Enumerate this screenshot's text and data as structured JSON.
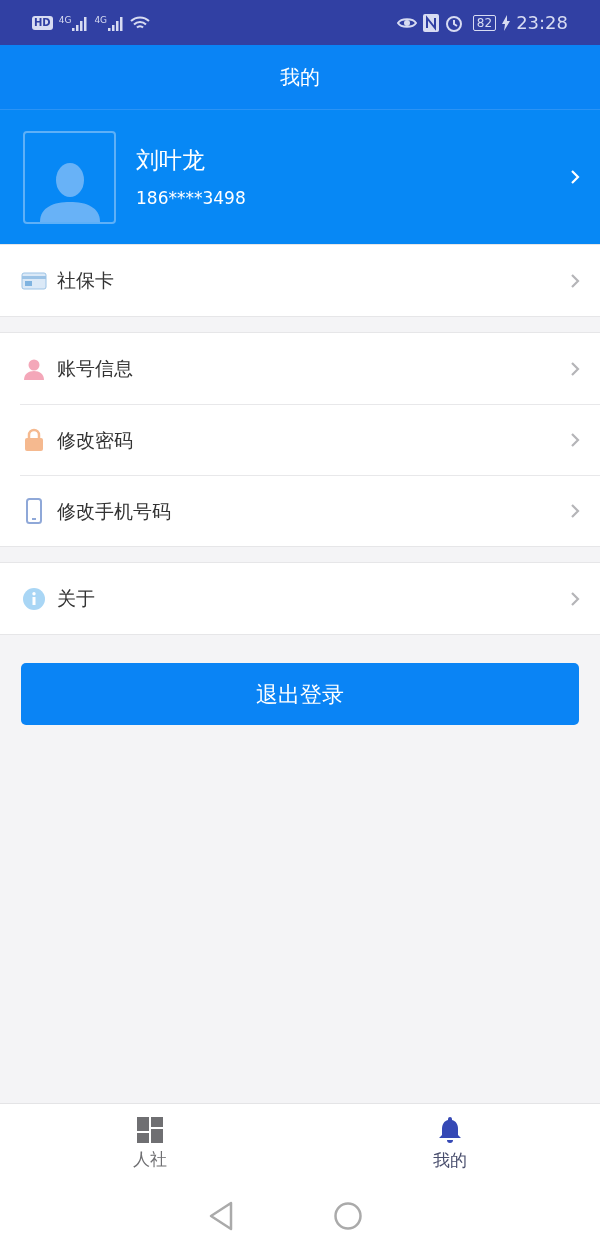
{
  "status_bar": {
    "hd": "HD",
    "networks": [
      "4G",
      "4G"
    ],
    "battery": "82",
    "time": "23:28"
  },
  "header": {
    "title": "我的"
  },
  "profile": {
    "name": "刘叶龙",
    "phone": "186****3498"
  },
  "menu_groups": [
    {
      "items": [
        {
          "label": "社保卡",
          "kind": "card"
        }
      ]
    },
    {
      "items": [
        {
          "label": "账号信息",
          "kind": "person"
        },
        {
          "label": "修改密码",
          "kind": "lock"
        },
        {
          "label": "修改手机号码",
          "kind": "phone"
        }
      ]
    },
    {
      "items": [
        {
          "label": "关于",
          "kind": "info"
        }
      ]
    }
  ],
  "logout_button": "退出登录",
  "bottom_tabs": [
    {
      "label": "人社",
      "kind": "grid",
      "selected": false
    },
    {
      "label": "我的",
      "kind": "bell",
      "selected": true
    }
  ]
}
